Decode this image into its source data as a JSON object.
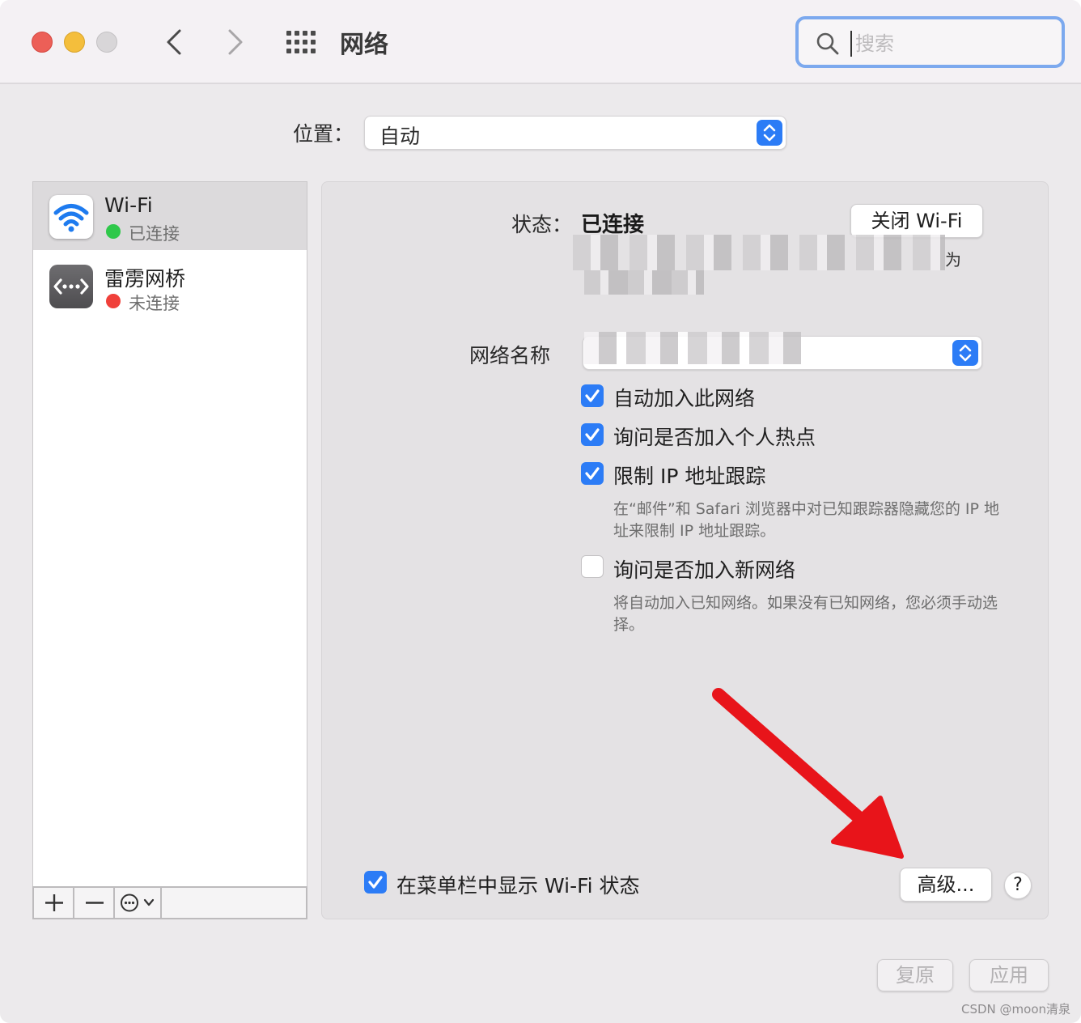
{
  "window": {
    "title": "网络",
    "search_placeholder": "搜索"
  },
  "location": {
    "label": "位置：",
    "value": "自动"
  },
  "sidebar": {
    "services": [
      {
        "name": "Wi-Fi",
        "status": "已连接",
        "status_color": "#2FC84A"
      },
      {
        "name": "雷雳网桥",
        "status": "未连接",
        "status_color": "#F0403A"
      }
    ],
    "toolbar": {
      "add": "+",
      "remove": "−",
      "more": "⊙⌄"
    }
  },
  "wifi": {
    "status_label": "状态：",
    "status_value": "已连接",
    "turn_off_button": "关闭 Wi-Fi",
    "network_name_label": "网络名称",
    "options": [
      {
        "label": "自动加入此网络",
        "checked": true
      },
      {
        "label": "询问是否加入个人热点",
        "checked": true
      },
      {
        "label": "限制 IP 地址跟踪",
        "checked": true,
        "description": "在“邮件”和 Safari 浏览器中对已知跟踪器隐藏您的 IP 地址来限制 IP 地址跟踪。"
      },
      {
        "label": "询问是否加入新网络",
        "checked": false,
        "description": "将自动加入已知网络。如果没有已知网络，您必须手动选择。"
      }
    ],
    "show_in_menubar_label": "在菜单栏中显示 Wi-Fi 状态",
    "show_in_menubar_checked": true,
    "status_detail_fragment": "为"
  },
  "buttons": {
    "advanced": "高级...",
    "help": "?",
    "revert": "复原",
    "apply": "应用"
  },
  "watermark": "CSDN @moon清泉",
  "colors": {
    "accent": "#2C7CF6",
    "arrow": "#E8141A"
  }
}
